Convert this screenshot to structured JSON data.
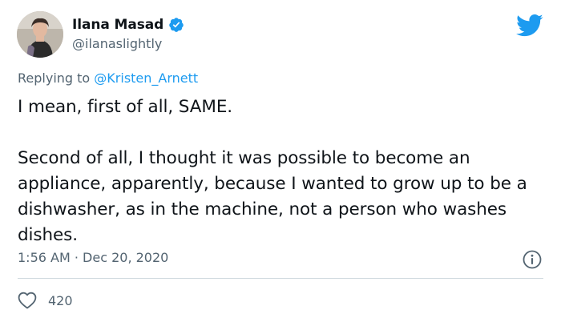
{
  "author": {
    "display_name": "Ilana Masad",
    "handle": "@ilanaslightly",
    "verified": true
  },
  "reply": {
    "prefix": "Replying to ",
    "to_handle": "@Kristen_Arnett"
  },
  "tweet": {
    "text": "I mean, first of all, SAME.\n\nSecond of all, I thought it was possible to become an appliance, apparently, because I wanted to grow up to be a dishwasher, as in the machine, not a person who washes dishes.",
    "time": "1:56 AM",
    "separator": "·",
    "date": "Dec 20, 2020"
  },
  "stats": {
    "likes": "420"
  },
  "icons": {
    "verified": "verified-badge-icon",
    "logo": "twitter-bird-icon",
    "info": "info-icon",
    "like": "heart-icon"
  },
  "colors": {
    "accent": "#1d9bf0",
    "text": "#0f1419",
    "muted": "#536471",
    "divider": "#cfd9de"
  }
}
